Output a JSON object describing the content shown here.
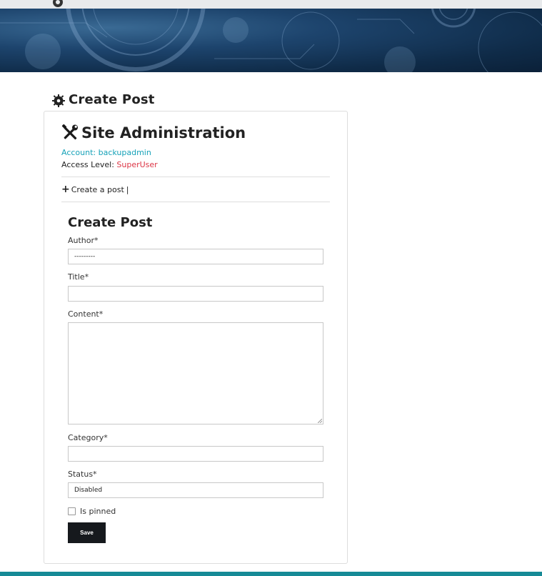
{
  "page": {
    "title": "Create Post"
  },
  "admin": {
    "heading": "Site Administration",
    "account_line": "Account: backupadmin",
    "access_prefix": "Access Level: ",
    "access_level": "SuperUser"
  },
  "nav": {
    "create_post_link": "Create a post",
    "separator": "|"
  },
  "form": {
    "heading": "Create Post",
    "author_label": "Author*",
    "author_value": "---------",
    "title_label": "Title*",
    "title_value": "",
    "content_label": "Content*",
    "content_value": "",
    "category_label": "Category*",
    "category_value": "",
    "status_label": "Status*",
    "status_value": "Disabled",
    "pinned_label": "Is pinned",
    "pinned_checked": false,
    "save_label": "Save"
  },
  "colors": {
    "link": "#17a2b8",
    "danger": "#dc3545",
    "button": "#16191d",
    "footer": "#168a96",
    "banner": "#1d446d"
  },
  "icons": {
    "page_title_icon": "gear-icon",
    "admin_icon": "tools-icon",
    "nav_icon": "plus-icon"
  }
}
